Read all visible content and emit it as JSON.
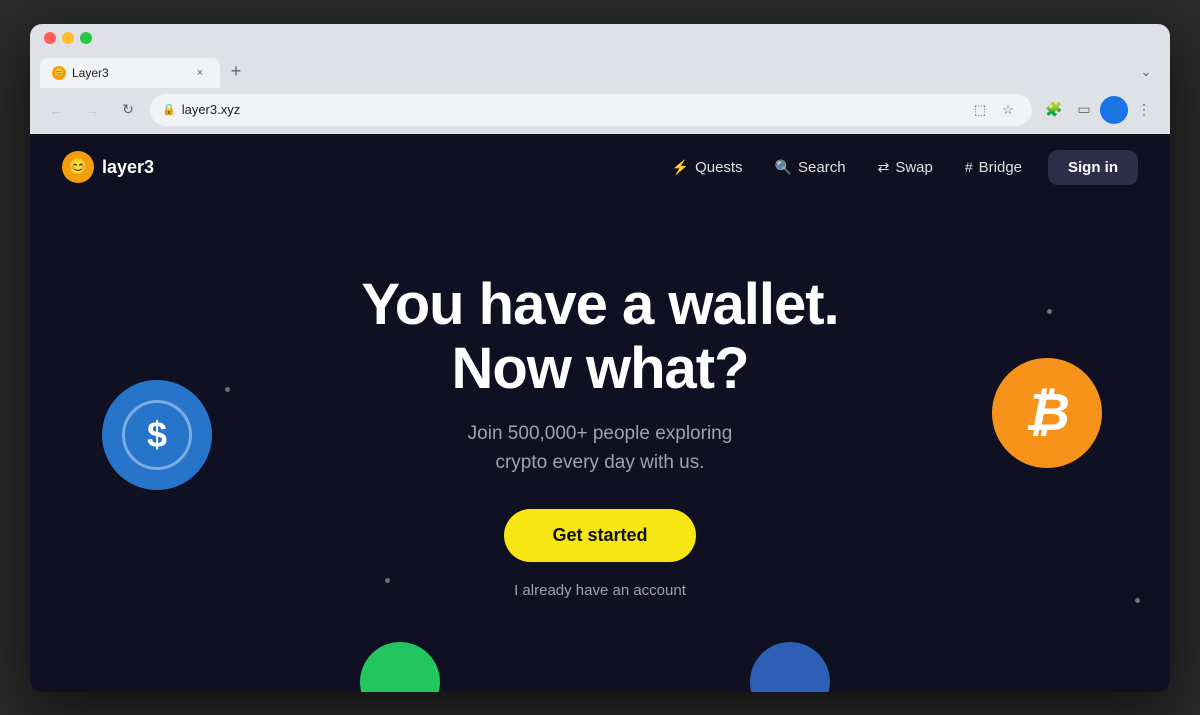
{
  "browser": {
    "tab": {
      "favicon_label": "😊",
      "title": "Layer3",
      "close_label": "×"
    },
    "new_tab_label": "+",
    "expand_label": "⌄",
    "nav": {
      "back_label": "←",
      "forward_label": "→",
      "reload_label": "↻"
    },
    "address_bar": {
      "lock_label": "🔒",
      "url": "layer3.xyz"
    },
    "toolbar_icons": {
      "screenshot": "⬚",
      "bookmark": "☆",
      "extensions": "🧩",
      "sidebar": "▭",
      "profile": "👤",
      "menu": "⋮"
    }
  },
  "site": {
    "logo": {
      "icon_label": "😊",
      "text": "layer3"
    },
    "nav": {
      "quests_label": "Quests",
      "quests_icon": "⚡",
      "search_label": "Search",
      "search_icon": "🔍",
      "swap_label": "Swap",
      "swap_icon": "⇄",
      "bridge_label": "Bridge",
      "bridge_icon": "#",
      "sign_in_label": "Sign in"
    },
    "hero": {
      "title_line1": "You have a wallet.",
      "title_line2": "Now what?",
      "subtitle": "Join 500,000+ people exploring\ncrypto every day with us.",
      "cta_label": "Get started",
      "login_label": "I already have an account"
    },
    "coins": {
      "usdc_symbol": "$",
      "btc_symbol": "₿"
    }
  }
}
